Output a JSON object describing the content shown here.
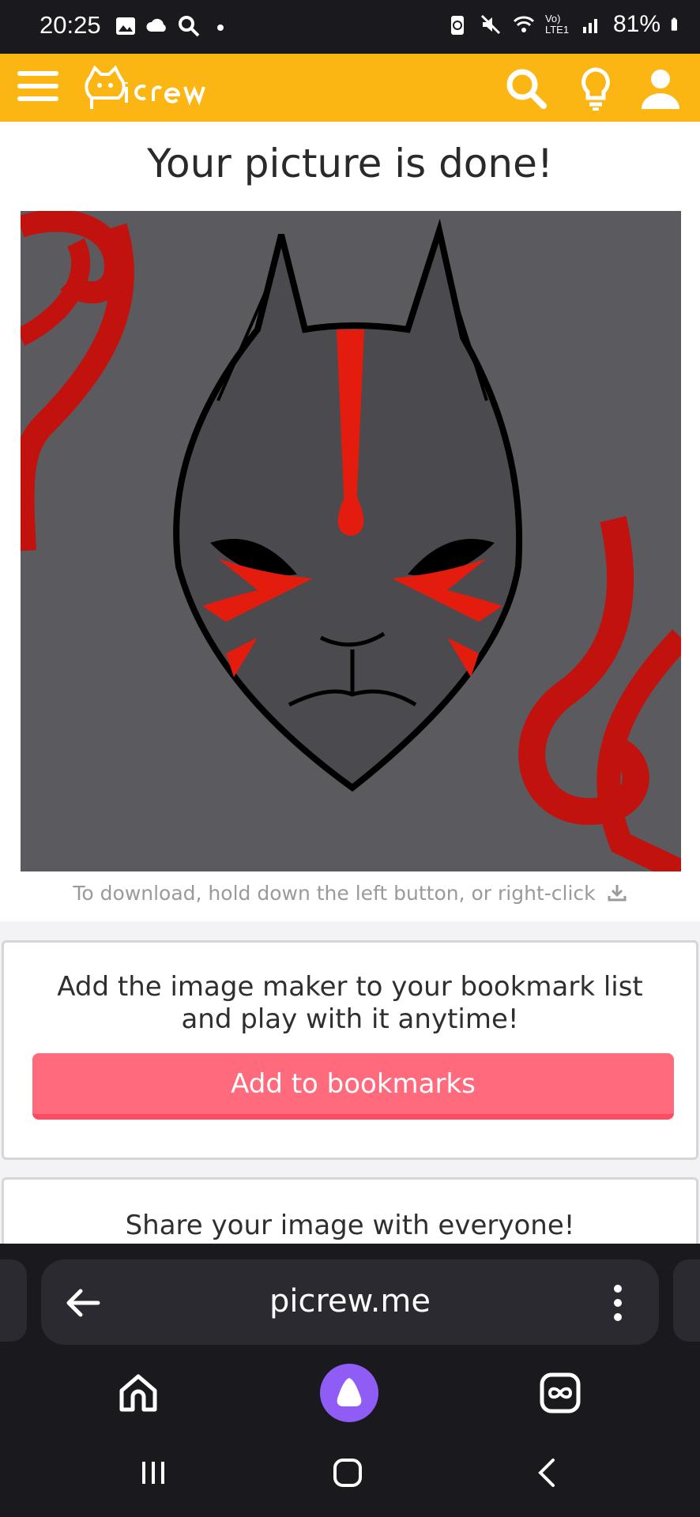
{
  "status_bar": {
    "time": "20:25",
    "battery": "81%",
    "network_label": "Vo) LTE1",
    "icons_left": [
      "image-icon",
      "cloud-icon",
      "search-icon",
      "dot-icon"
    ],
    "icons_right": [
      "battery-saver-icon",
      "mute-icon",
      "wifi-icon",
      "signal-icon",
      "battery-icon"
    ]
  },
  "header": {
    "logo_text": "Picrew",
    "icons": [
      "menu-icon",
      "search-icon",
      "lightbulb-icon",
      "user-icon"
    ],
    "brand_color": "#fbb613"
  },
  "main": {
    "title": "Your picture is done!",
    "image_description_icon": "kitsune-mask",
    "download_hint": "To download, hold down the left button, or right-click"
  },
  "bookmark_card": {
    "text_line1": "Add the image maker to your bookmark list",
    "text_line2": "and play with it anytime!",
    "button_label": "Add to bookmarks",
    "button_color": "#ff6b7d"
  },
  "share_card": {
    "text": "Share your image with everyone!"
  },
  "browser": {
    "url": "picrew.me",
    "nav_icons": [
      "home-icon",
      "assistant-icon",
      "tabs-icon"
    ],
    "system_icons": [
      "recents-icon",
      "home-circle-icon",
      "back-chevron-icon"
    ]
  }
}
